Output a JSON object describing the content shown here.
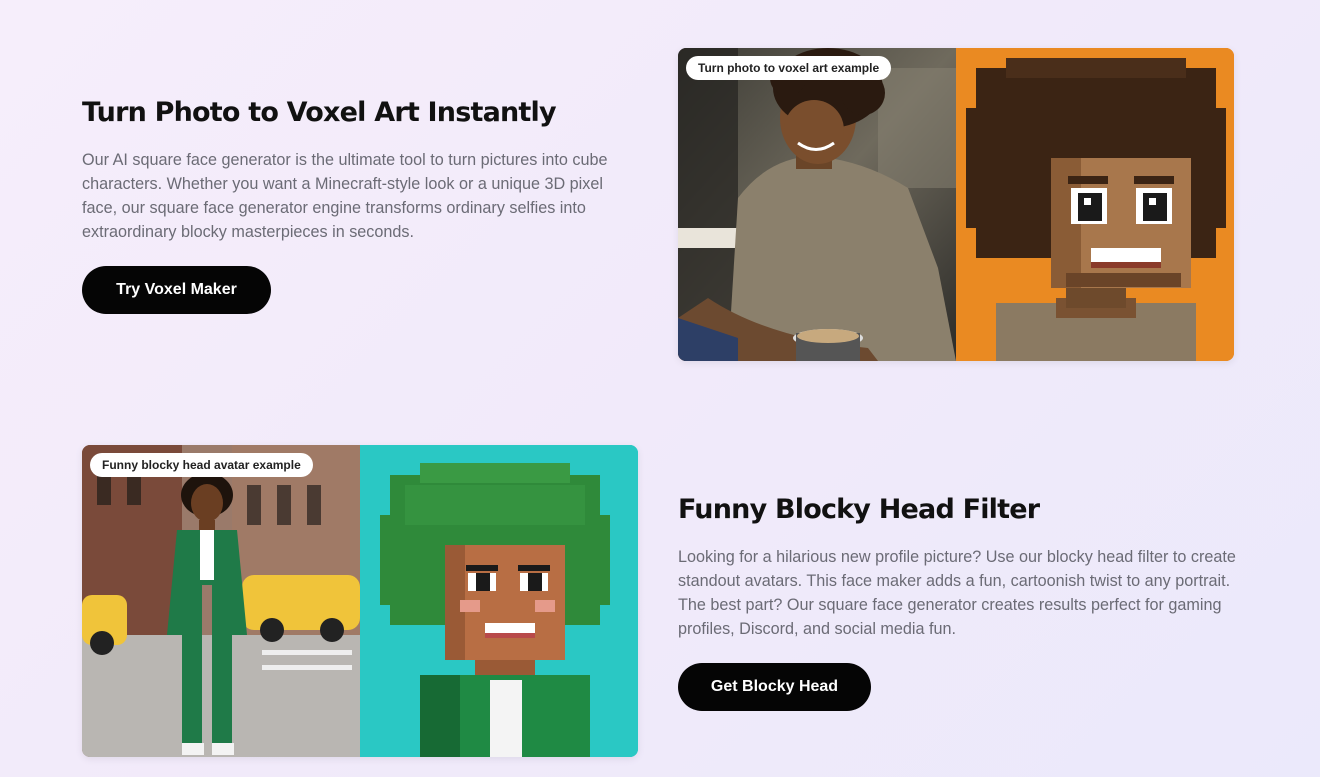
{
  "feature1": {
    "title": "Turn Photo to Voxel Art Instantly",
    "description": "Our AI square face generator is the ultimate tool to turn pictures into cube characters. Whether you want a Minecraft-style look or a unique 3D pixel face, our square face generator engine transforms ordinary selfies into extraordinary blocky masterpieces in seconds.",
    "button_label": "Try Voxel Maker",
    "image_label": "Turn photo to voxel art example"
  },
  "feature2": {
    "title": "Funny Blocky Head Filter",
    "description": "Looking for a hilarious new profile picture? Use our blocky head filter to create standout avatars. This face maker adds a fun, cartoonish twist to any portrait. The best part? Our square face generator creates results perfect for gaming profiles, Discord, and social media fun.",
    "button_label": "Get Blocky Head",
    "image_label": "Funny blocky head avatar example"
  },
  "colors": {
    "button_bg": "#050505",
    "voxel_bg_orange": "#ea8a22",
    "voxel_bg_teal": "#2ac8c4",
    "suit_green": "#1f7a48"
  }
}
